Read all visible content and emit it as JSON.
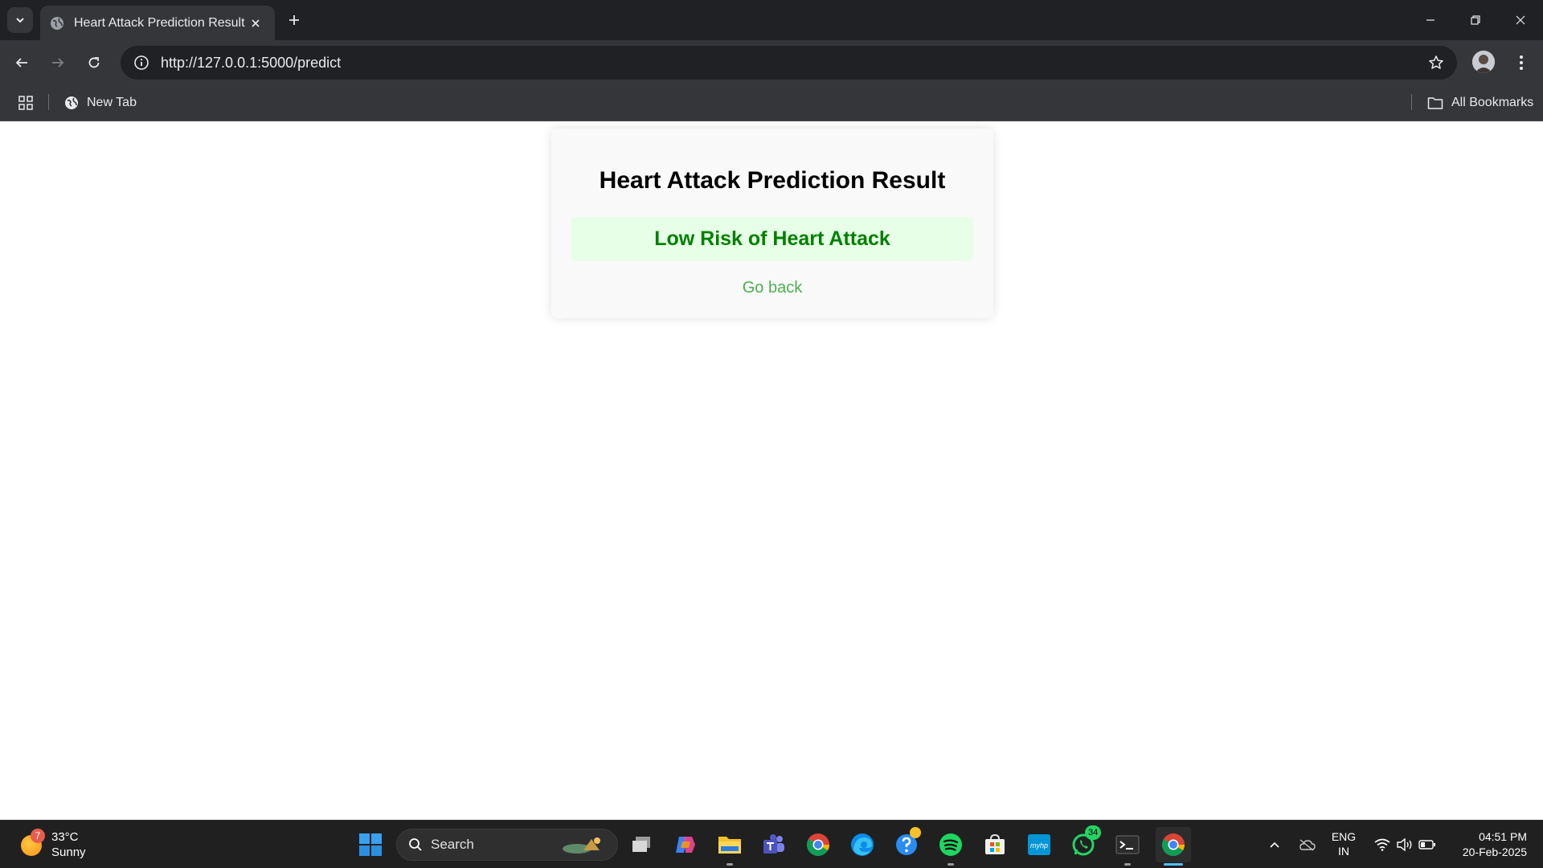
{
  "browser": {
    "tab_title": "Heart Attack Prediction Result",
    "url": "http://127.0.0.1:5000/predict",
    "bookmarks": [
      {
        "label": "New Tab",
        "icon": "globe-icon"
      }
    ],
    "all_bookmarks_label": "All Bookmarks"
  },
  "page": {
    "title": "Heart Attack Prediction Result",
    "result": "Low Risk of Heart Attack",
    "back_link": "Go back",
    "colors": {
      "result_text": "#008000",
      "result_bg": "#e6ffe6",
      "link": "#4caf50"
    }
  },
  "taskbar": {
    "weather": {
      "badge": "7",
      "temperature": "33°C",
      "condition": "Sunny"
    },
    "search_placeholder": "Search",
    "whatsapp_badge": "34",
    "language": {
      "line1": "ENG",
      "line2": "IN"
    },
    "time": "04:51 PM",
    "date": "20-Feb-2025"
  }
}
